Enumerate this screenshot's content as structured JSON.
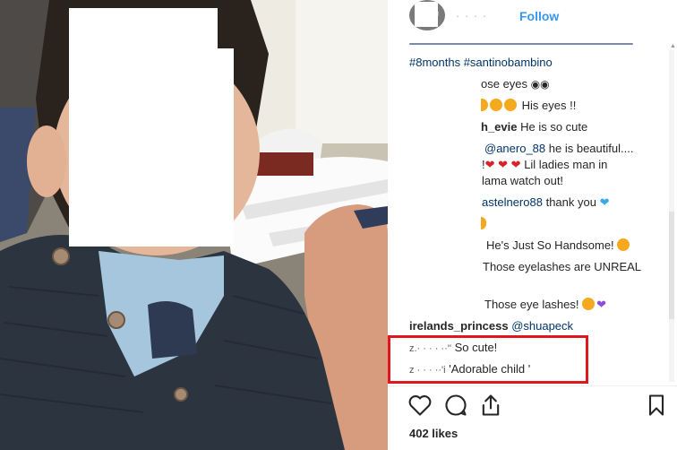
{
  "header": {
    "username_masked": "·   ·  ·  ·",
    "follow_label": "Follow"
  },
  "caption": {
    "hashtags_line": "#8months #santinobambino"
  },
  "comments": [
    {
      "text": "ose eyes"
    },
    {
      "text": "His eyes !!"
    },
    {
      "user": "h_evie",
      "text": "He is so cute"
    },
    {
      "mention": "@anero_88",
      "text": "he is beautiful...."
    },
    {
      "text": "Lil ladies man in"
    },
    {
      "text": "lama watch out!"
    },
    {
      "mention": "astelnero88",
      "text": "thank you"
    },
    {
      "text": "He's Just So Handsome!"
    },
    {
      "text": "Those eyelashes are UNREAL"
    },
    {
      "text": "Those eye lashes!"
    },
    {
      "user": "irelands_princess",
      "mention": "@shuapeck"
    },
    {
      "user_masked": "z.·  · ·  ·  ··''",
      "text": "So cute!"
    },
    {
      "user_masked": "z   ·  · ·  ··'i",
      "text": "'Adorable child '"
    }
  ],
  "likes_text": "402 likes",
  "icons": [
    "heart-icon",
    "comment-icon",
    "share-icon",
    "bookmark-icon",
    "eyes-emoji",
    "heart-eyes-emoji",
    "blue-heart-emoji",
    "purple-heart-emoji"
  ],
  "colors": {
    "accent": "#3897f0",
    "highlight_box": "#e0171f",
    "hashtag": "#003569"
  }
}
